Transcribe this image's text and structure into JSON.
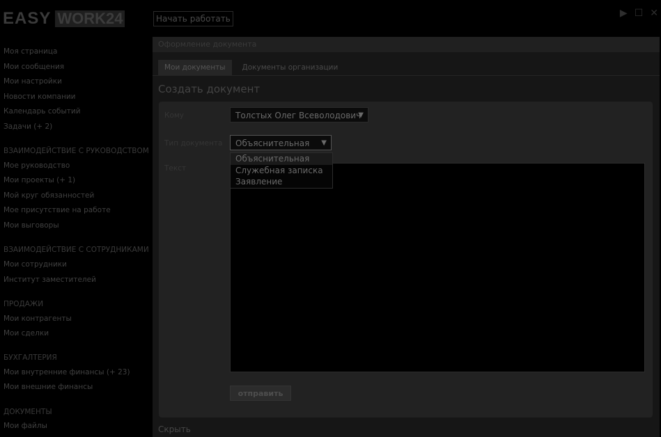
{
  "app": {
    "logo_part1": "EASY",
    "logo_part2": "WORK24",
    "start_button": "Начать работать",
    "window_controls": [
      "play-icon",
      "maximize-icon",
      "close-icon"
    ]
  },
  "sidebar": {
    "items": [
      {
        "label": "Моя страница",
        "type": "link"
      },
      {
        "label": "Мои сообщения",
        "type": "link"
      },
      {
        "label": "Мои настройки",
        "type": "link"
      },
      {
        "label": "Новости компании",
        "type": "link"
      },
      {
        "label": "Календарь событий",
        "type": "link"
      },
      {
        "label": "Задачи (+ 2)",
        "type": "link"
      },
      {
        "label": "ВЗАИМОДЕЙСТВИЕ С РУКОВОДСТВОМ",
        "type": "header"
      },
      {
        "label": "Мое руководство",
        "type": "link"
      },
      {
        "label": "Мои проекты (+ 1)",
        "type": "link"
      },
      {
        "label": "Мой круг обязанностей",
        "type": "link"
      },
      {
        "label": "Мое присутствие на работе",
        "type": "link"
      },
      {
        "label": "Мои выговоры",
        "type": "link"
      },
      {
        "label": "ВЗАИМОДЕЙСТВИЕ С СОТРУДНИКАМИ",
        "type": "header"
      },
      {
        "label": "Мои сотрудники",
        "type": "link"
      },
      {
        "label": "Институт заместителей",
        "type": "link"
      },
      {
        "label": "ПРОДАЖИ",
        "type": "header"
      },
      {
        "label": "Мои контрагенты",
        "type": "link"
      },
      {
        "label": "Мои сделки",
        "type": "link"
      },
      {
        "label": "БУХГАЛТЕРИЯ",
        "type": "header"
      },
      {
        "label": "Мои внутренние финансы (+ 23)",
        "type": "link"
      },
      {
        "label": "Мои внешние финансы",
        "type": "link"
      },
      {
        "label": "ДОКУМЕНТЫ",
        "type": "header"
      },
      {
        "label": "Мои файлы",
        "type": "link"
      }
    ]
  },
  "panel": {
    "title": "Оформление документа",
    "tabs": [
      {
        "label": "Мои документы",
        "active": true
      },
      {
        "label": "Документы организации",
        "active": false
      }
    ],
    "create_title": "Создать документ",
    "form": {
      "to_label": "Кому",
      "to_value": "Толстых Олег Всеволодович",
      "doctype_label": "Тип документа",
      "doctype_value": "Объяснительная",
      "doctype_options": [
        "Объяснительная",
        "Служебная записка",
        "Заявление"
      ],
      "text_label": "Текст",
      "text_value": "",
      "send_button": "отправить"
    },
    "hide_link": "Скрыть"
  },
  "colors": {
    "background": "#000000",
    "panel": "#161616",
    "form_box": "#222222"
  }
}
